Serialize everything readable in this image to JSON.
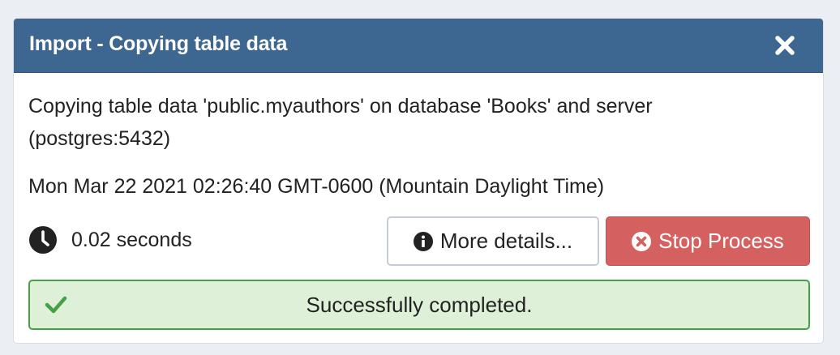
{
  "dialog": {
    "title": "Import - Copying table data",
    "close_icon": "close-icon"
  },
  "content": {
    "message": "Copying table data 'public.myauthors' on database 'Books' and server (postgres:5432)",
    "timestamp": "Mon Mar 22 2021 02:26:40 GMT-0600 (Mountain Daylight Time)",
    "elapsed": "0.02 seconds",
    "clock_icon": "clock-icon"
  },
  "buttons": {
    "details_label": "More details...",
    "details_icon": "info-circle-icon",
    "stop_label": "Stop Process",
    "stop_icon": "times-circle-icon"
  },
  "status": {
    "text": "Successfully completed.",
    "icon": "check-icon"
  },
  "colors": {
    "header": "#3d6791",
    "stop_button": "#d4605f",
    "success_background": "#dff0d8",
    "success_border": "#46a145"
  }
}
